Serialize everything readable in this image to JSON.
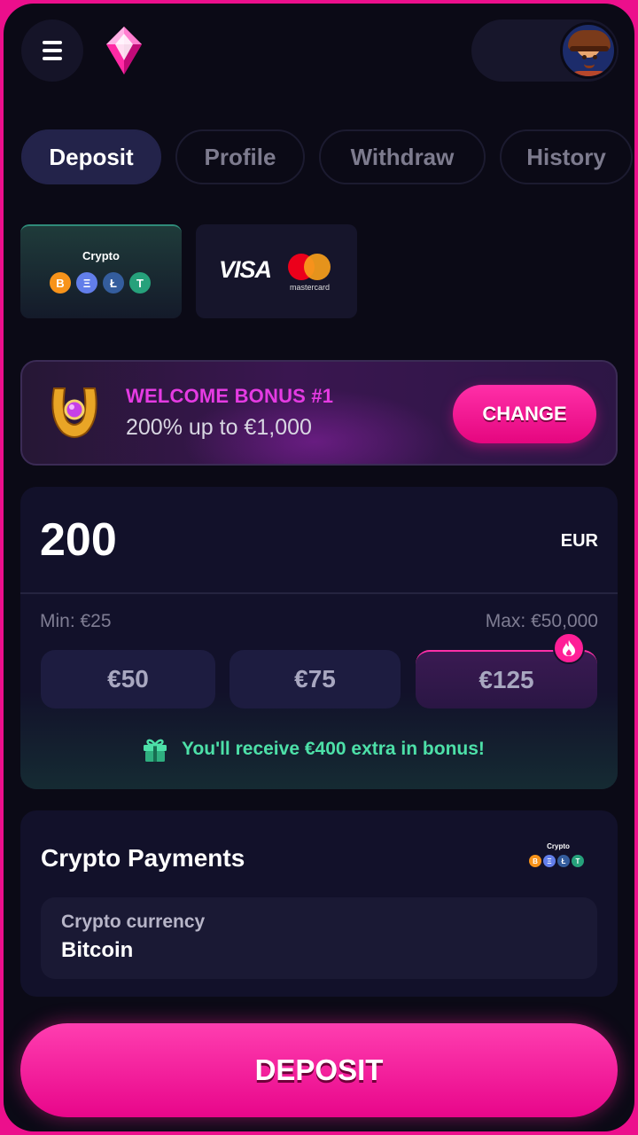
{
  "header": {
    "menu_icon": "hamburger-menu-icon",
    "logo_icon": "gem-logo-icon",
    "avatar_icon": "cowboy-avatar-icon"
  },
  "tabs": [
    {
      "label": "Deposit",
      "active": true
    },
    {
      "label": "Profile",
      "active": false
    },
    {
      "label": "Withdraw",
      "active": false
    },
    {
      "label": "History",
      "active": false
    }
  ],
  "payment_methods": {
    "crypto": {
      "label": "Crypto",
      "coins": [
        "B",
        "Ξ",
        "Ł",
        "T"
      ],
      "selected": true
    },
    "card": {
      "visa_label": "VISA",
      "mastercard_label": "mastercard",
      "selected": false
    }
  },
  "bonus": {
    "icon": "horseshoe-icon",
    "title": "WELCOME BONUS #1",
    "subtitle": "200% up to €1,000",
    "change_label": "CHANGE"
  },
  "amount": {
    "value": "200",
    "currency": "EUR",
    "min_label": "Min: €25",
    "max_label": "Max: €50,000",
    "presets": [
      "€50",
      "€75",
      "€125"
    ],
    "highlighted_preset": "€125",
    "hot_icon": "fire-icon",
    "bonus_note_icon": "gift-icon",
    "bonus_note": "You'll receive €400 extra in bonus!"
  },
  "crypto_payments": {
    "title": "Crypto Payments",
    "logo_label": "Crypto",
    "field_label": "Crypto currency",
    "field_value": "Bitcoin"
  },
  "deposit_button": {
    "label": "DEPOSIT"
  },
  "colors": {
    "accent": "#ff1f97",
    "background": "#0b0a16",
    "bonus_title": "#e53be3",
    "success_text": "#4de0a8"
  }
}
